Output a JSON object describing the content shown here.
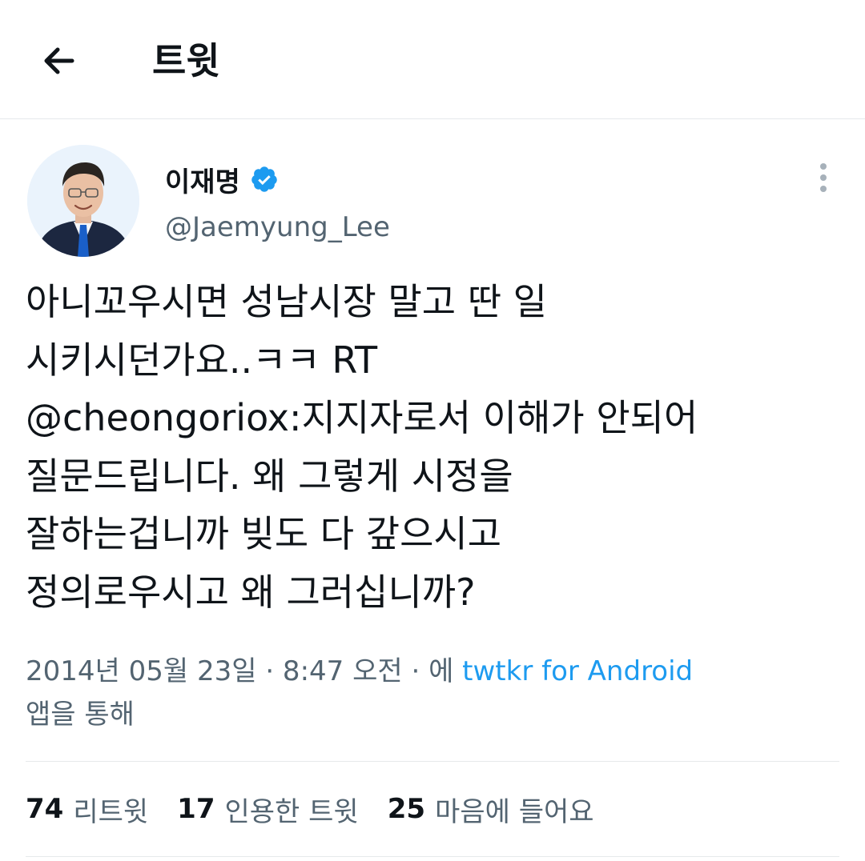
{
  "header": {
    "title": "트윗"
  },
  "tweet": {
    "display_name": "이재명",
    "handle": "@Jaemyung_Lee",
    "text_lines": [
      "아니꼬우시면 성남시장 말고 딴 일",
      "시키시던가요..ㅋㅋ RT",
      "@cheongoriox:지지자로서 이해가 안되어",
      "질문드립니다. 왜 그렇게 시정을",
      "잘하는겁니까 빚도 다 갚으시고",
      "정의로우시고 왜 그러십니까?"
    ],
    "timestamp": "2014년 05월 23일 · 8:47 오전 · 에 ",
    "source_link": "twtkr for Android",
    "source_suffix": "앱을 통해"
  },
  "stats": [
    {
      "count": "74",
      "label": "리트윗"
    },
    {
      "count": "17",
      "label": "인용한 트윗"
    },
    {
      "count": "25",
      "label": "마음에 들어요"
    }
  ],
  "colors": {
    "accent": "#1d9bf0",
    "secondary_text": "#536471",
    "primary_text": "#0f1419",
    "divider": "#e6e9eb"
  },
  "icons": {
    "back": "arrow-left-icon",
    "verified": "verified-badge-icon",
    "more": "more-vertical-icon"
  }
}
